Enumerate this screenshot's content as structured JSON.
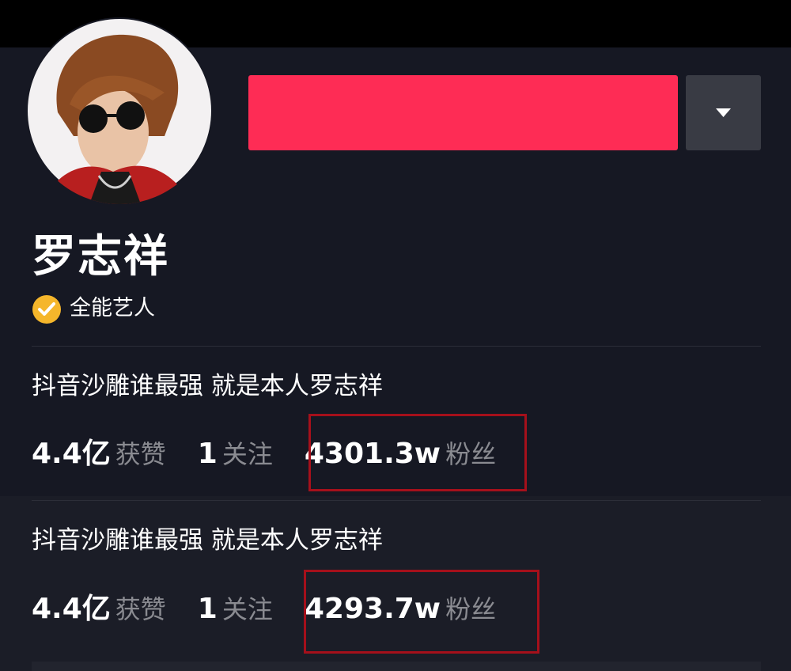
{
  "profile": {
    "name": "罗志祥",
    "verification_label": "全能艺人",
    "avatar_icon": "avatar-photo",
    "follow_button_color": "#fe2c55",
    "dropdown_icon": "caret-down-icon"
  },
  "snapshots": [
    {
      "bio": "抖音沙雕谁最强 就是本人罗志祥",
      "likes_value": "4.4亿",
      "likes_label": "获赞",
      "following_value": "1",
      "following_label": "关注",
      "followers_value": "4301.3w",
      "followers_label": "粉丝"
    },
    {
      "bio": "抖音沙雕谁最强 就是本人罗志祥",
      "likes_value": "4.4亿",
      "likes_label": "获赞",
      "following_value": "1",
      "following_label": "关注",
      "followers_value": "4293.7w",
      "followers_label": "粉丝"
    }
  ],
  "colors": {
    "background": "#161823",
    "accent": "#fe2c55",
    "verify_badge": "#f5b62b",
    "highlight_box": "#a5101b"
  }
}
